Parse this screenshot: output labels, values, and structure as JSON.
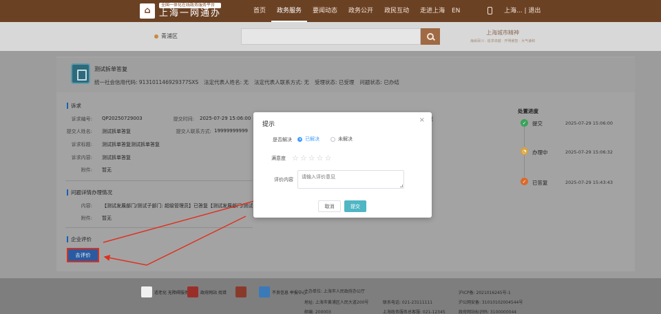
{
  "header": {
    "logo_sub": "全国一体化在线政务服务平台",
    "logo_main": "上海一网通办",
    "nav": [
      "首页",
      "政务服务",
      "要闻动态",
      "政务公开",
      "政民互动",
      "走进上海"
    ],
    "active_nav": "政务服务",
    "lang": "EN",
    "user": "上海... | 退出"
  },
  "search": {
    "location": "青浦区",
    "placeholder": "",
    "slogan_main": "上海城市精神",
    "slogan_sub": "海纳百川 · 追求卓越 · 开明睿智 · 大气谦和"
  },
  "company": {
    "name": "测试拆单答复",
    "credit_code": "统一社会信用代码: 913101146929377SXS",
    "legal_name": "法定代表人姓名: 无",
    "legal_contact": "法定代表人联系方式: 无",
    "accept_status": "受理状态: 已受理",
    "problem_status": "问题状态: 已办结"
  },
  "appeal": {
    "title": "诉求",
    "labels": {
      "no": "诉求编号:",
      "time": "提交时间:",
      "submitter": "提交人姓名:",
      "contact": "提交人联系方式:",
      "subject": "诉求标题:",
      "content": "诉求内容:",
      "attachment": "附件:"
    },
    "values": {
      "no": "QP20250729003",
      "time": "2025-07-29 15:06:00",
      "submitter": "测试拆单答复",
      "contact": "19999999999",
      "subject": "测试拆单答复测试拆单答复",
      "content": "测试拆单答复",
      "attachment": "暂无",
      "trunc": "复"
    }
  },
  "handling": {
    "title": "问题详情办理情况",
    "content_label": "内容:",
    "content_value": "【测试发展部门/测试子部门: 超级管理员】已答复【测试发展部门/测试子",
    "attachment_label": "附件:",
    "attachment_value": "暂无"
  },
  "evaluation": {
    "title": "企业评价",
    "button": "去评价"
  },
  "progress": {
    "title": "处置进度",
    "steps": [
      {
        "label": "提交",
        "time": "2025-07-29 15:06:00",
        "color": "#3aa35a",
        "icon": "check-icon"
      },
      {
        "label": "办理中",
        "time": "2025-07-29 15:06:32",
        "color": "#d9a23a",
        "icon": "clock-icon"
      },
      {
        "label": "已答复",
        "time": "2025-07-29 15:43:43",
        "color": "#d96a2a",
        "icon": "reply-icon"
      }
    ]
  },
  "modal": {
    "title": "提示",
    "resolved_label": "是否解决",
    "opt_resolved": "已解决",
    "opt_unresolved": "未解决",
    "satisfaction_label": "满意度",
    "stars": 5,
    "comment_label": "评价内容",
    "comment_placeholder": "请输入评价意见",
    "cancel": "取消",
    "submit": "提交"
  },
  "footer": {
    "badge1": "适老化 无障碍服务",
    "badge2": "政府网站 找错",
    "badge3": "不良信息 举报中心",
    "host": "主办单位: 上海市人民政府办公厅",
    "address": "地址: 上海市黄浦区人民大道200号",
    "zip": "邮编: 200003",
    "phone": "联系电话: 021-23111111",
    "gov_phone": "上海政务服务总客服: 021-12345",
    "icp": "沪ICP备: 2021016245号-1",
    "police": "沪公网安备: 31010102004544号",
    "site_code": "政府网站标识码: 3100000044"
  }
}
